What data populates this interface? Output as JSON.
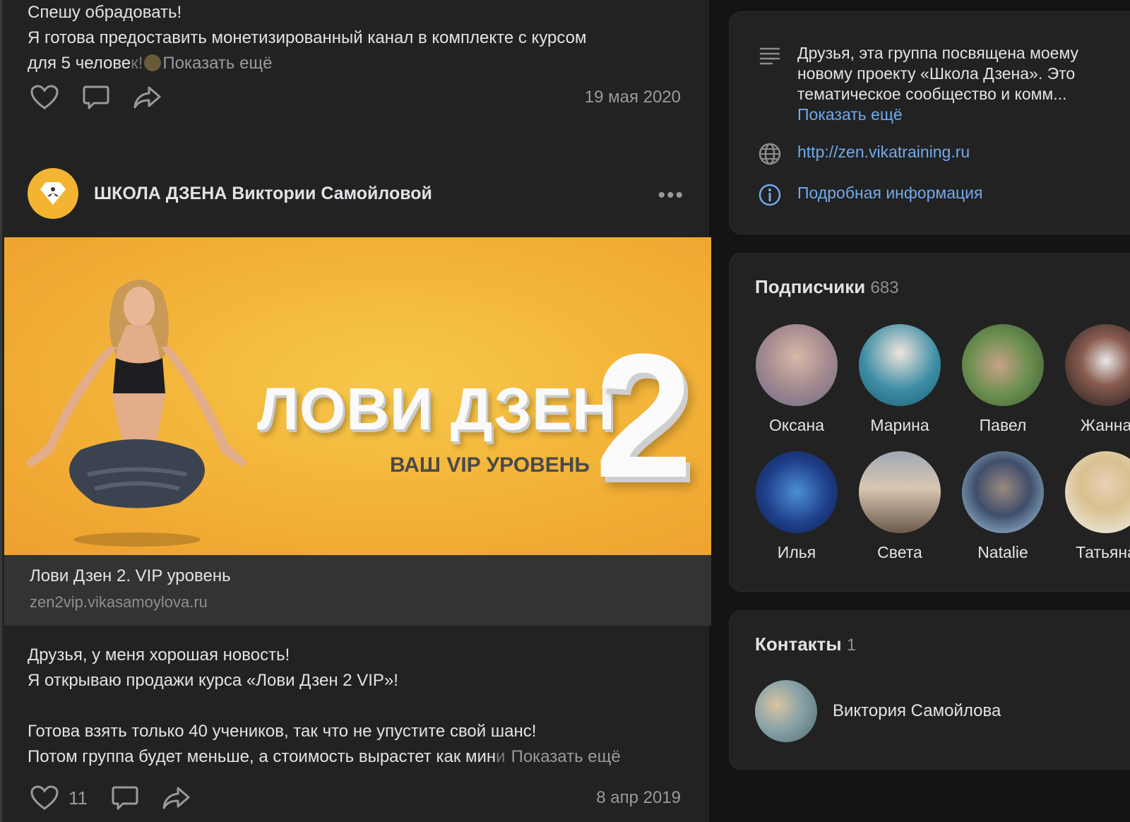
{
  "post_top": {
    "line1": "Спешу обрадовать!",
    "line2": "Я готова предоставить монетизированный канал в комплекте с курсом",
    "line3": "для 5 челове",
    "line3_faded": "к!",
    "show_more": "Показать ещё",
    "date": "19 мая 2020"
  },
  "post": {
    "author": "ШКОЛА ДЗЕНА Виктории Самойловой",
    "more_menu": "•••",
    "banner": {
      "title": "ЛОВИ ДЗЕН",
      "subtitle": "ВАШ VIP УРОВЕНЬ",
      "number": "2"
    },
    "link_title": "Лови Дзен 2. VIP уровень",
    "link_url": "zen2vip.vikasamoylova.ru",
    "text": {
      "line1": "Друзья, у меня хорошая новость!",
      "line2": "Я открываю продажи курса «Лови Дзен 2 VIP»!",
      "line3": "Готова взять только 40 учеников, так что не упустите свой шанс!",
      "line4": "Потом группа будет меньше, а стоимость вырастет как мин",
      "line4_faded": "и",
      "show_more": "Показать ещё"
    },
    "likes": "11",
    "date": "8 апр 2019"
  },
  "about": {
    "description": "Друзья, эта группа посвящена моему новому проекту «Школа Дзена». Это тематическое сообщество и комм...",
    "show_more": "Показать ещё",
    "website": "http://zen.vikatraining.ru",
    "details": "Подробная информация"
  },
  "subscribers": {
    "title": "Подписчики",
    "count": "683",
    "people": [
      {
        "name": "Оксана"
      },
      {
        "name": "Марина"
      },
      {
        "name": "Павел"
      },
      {
        "name": "Жанна"
      },
      {
        "name": "Илья"
      },
      {
        "name": "Света"
      },
      {
        "name": "Natalie"
      },
      {
        "name": "Татьяна"
      }
    ]
  },
  "contacts": {
    "title": "Контакты",
    "count": "1",
    "name": "Виктория Самойлова"
  },
  "colors": {
    "background": "#141414",
    "panel": "#222222",
    "link_blue": "#71aaeb",
    "muted": "#9a9a9a",
    "banner_orange": "#f3b53a"
  }
}
